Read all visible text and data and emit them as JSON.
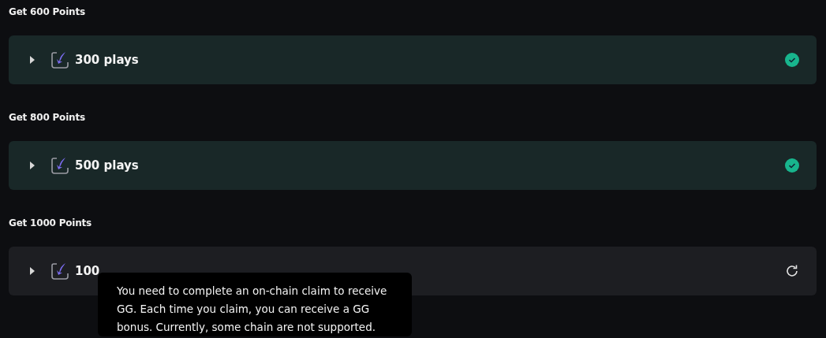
{
  "sections": [
    {
      "heading": "Get 600 Points",
      "task": {
        "label": "300 plays",
        "completed": true
      }
    },
    {
      "heading": "Get 800 Points",
      "task": {
        "label": "500 plays",
        "completed": true
      }
    },
    {
      "heading": "Get 1000 Points",
      "task": {
        "label": "100",
        "completed": false
      }
    }
  ],
  "tooltip": {
    "text": "You need to complete an on-chain claim to receive GG. Each time you claim, you can receive a GG bonus. Currently, some chain are not supported."
  }
}
